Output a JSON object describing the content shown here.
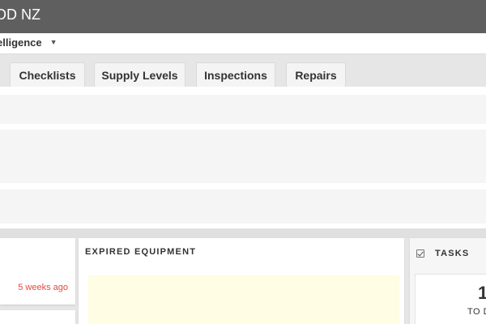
{
  "header": {
    "org_name": "OD NZ"
  },
  "subnav": {
    "selector_label": "elligence"
  },
  "tabs": [
    {
      "label": "Checklists"
    },
    {
      "label": "Supply Levels"
    },
    {
      "label": "Inspections"
    },
    {
      "label": "Repairs"
    }
  ],
  "left_card": {
    "time_ago": "5 weeks ago"
  },
  "expired_equipment": {
    "title": "EXPIRED EQUIPMENT"
  },
  "tasks": {
    "title": "TASKS",
    "count": "1",
    "count_label": "TO D"
  },
  "colors": {
    "topbar": "#5f5f5f",
    "overdue_text": "#e8473f",
    "alert_background": "#fffde3"
  }
}
